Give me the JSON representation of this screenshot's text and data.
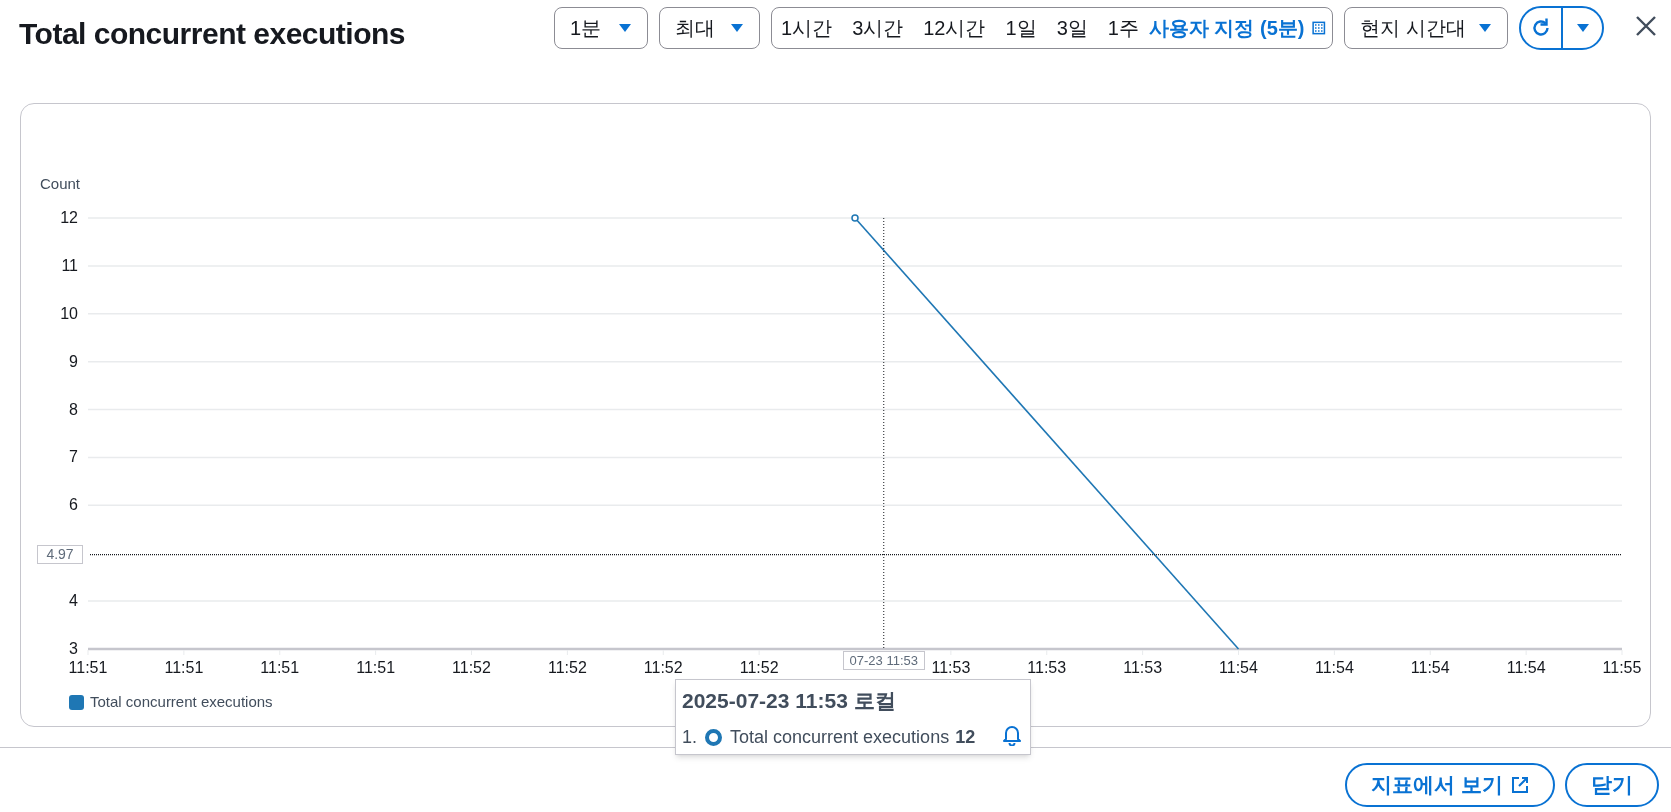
{
  "title": "Total concurrent executions",
  "toolbar": {
    "period": {
      "value": "1분"
    },
    "statistic": {
      "value": "최대"
    },
    "ranges": [
      {
        "label": "1시간",
        "selected": false
      },
      {
        "label": "3시간",
        "selected": false
      },
      {
        "label": "12시간",
        "selected": false
      },
      {
        "label": "1일",
        "selected": false
      },
      {
        "label": "3일",
        "selected": false
      },
      {
        "label": "1주",
        "selected": false
      },
      {
        "label": "사용자 지정 (5분)",
        "selected": true
      }
    ],
    "timezone": {
      "value": "현지 시간대"
    }
  },
  "chart": {
    "chart_data": {
      "type": "line",
      "ylabel": "Count",
      "categories": [
        "11:51",
        "11:51",
        "11:51",
        "11:51",
        "11:52",
        "11:52",
        "11:52",
        "11:52",
        null,
        "11:53",
        "11:53",
        "11:53",
        "11:54",
        "11:54",
        "11:54",
        "11:54",
        "11:55"
      ],
      "series": [
        {
          "name": "Total concurrent executions",
          "color": "#1f77b4",
          "values": [
            null,
            null,
            null,
            null,
            null,
            null,
            null,
            null,
            12,
            null,
            null,
            null,
            3,
            null,
            null,
            null,
            null
          ]
        }
      ],
      "ylim": [
        3,
        12
      ],
      "grid": true,
      "yticks": [
        3,
        4,
        6,
        7,
        8,
        9,
        10,
        11,
        12
      ]
    },
    "crosshair": {
      "x_label": "07-23 11:53",
      "y_label": "4.97"
    }
  },
  "tooltip": {
    "title": "2025-07-23 11:53 로컬",
    "items": [
      {
        "index": "1.",
        "name": "Total concurrent executions",
        "value": "12",
        "color": "#1f77b4"
      }
    ]
  },
  "buttons": [
    {
      "label": "지표에서 보기",
      "kind": "external"
    },
    {
      "label": "닫기",
      "kind": "plain"
    }
  ]
}
